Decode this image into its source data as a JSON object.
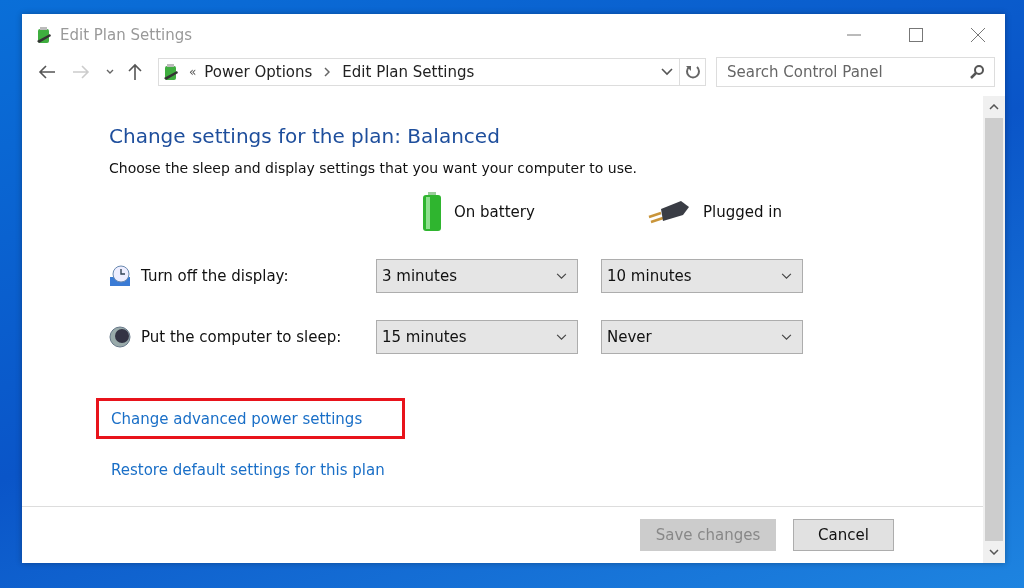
{
  "window": {
    "title": "Edit Plan Settings"
  },
  "address_bar": {
    "breadcrumbs": [
      {
        "label": "Power Options"
      },
      {
        "label": "Edit Plan Settings"
      }
    ],
    "overflow_mark": "«"
  },
  "search": {
    "placeholder": "Search Control Panel"
  },
  "heading": "Change settings for the plan: Balanced",
  "description": "Choose the sleep and display settings that you want your computer to use.",
  "columns": [
    {
      "kind": "battery",
      "label": "On battery"
    },
    {
      "kind": "plug",
      "label": "Plugged in"
    }
  ],
  "settings": [
    {
      "kind": "display",
      "label": "Turn off the display:",
      "values": [
        "3 minutes",
        "10 minutes"
      ]
    },
    {
      "kind": "sleep",
      "label": "Put the computer to sleep:",
      "values": [
        "15 minutes",
        "Never"
      ]
    }
  ],
  "links": [
    {
      "label": "Change advanced power settings",
      "highlighted": true
    },
    {
      "label": "Restore default settings for this plan",
      "highlighted": false
    }
  ],
  "buttons": [
    {
      "label": "Save changes",
      "disabled": true
    },
    {
      "label": "Cancel",
      "disabled": false
    }
  ]
}
